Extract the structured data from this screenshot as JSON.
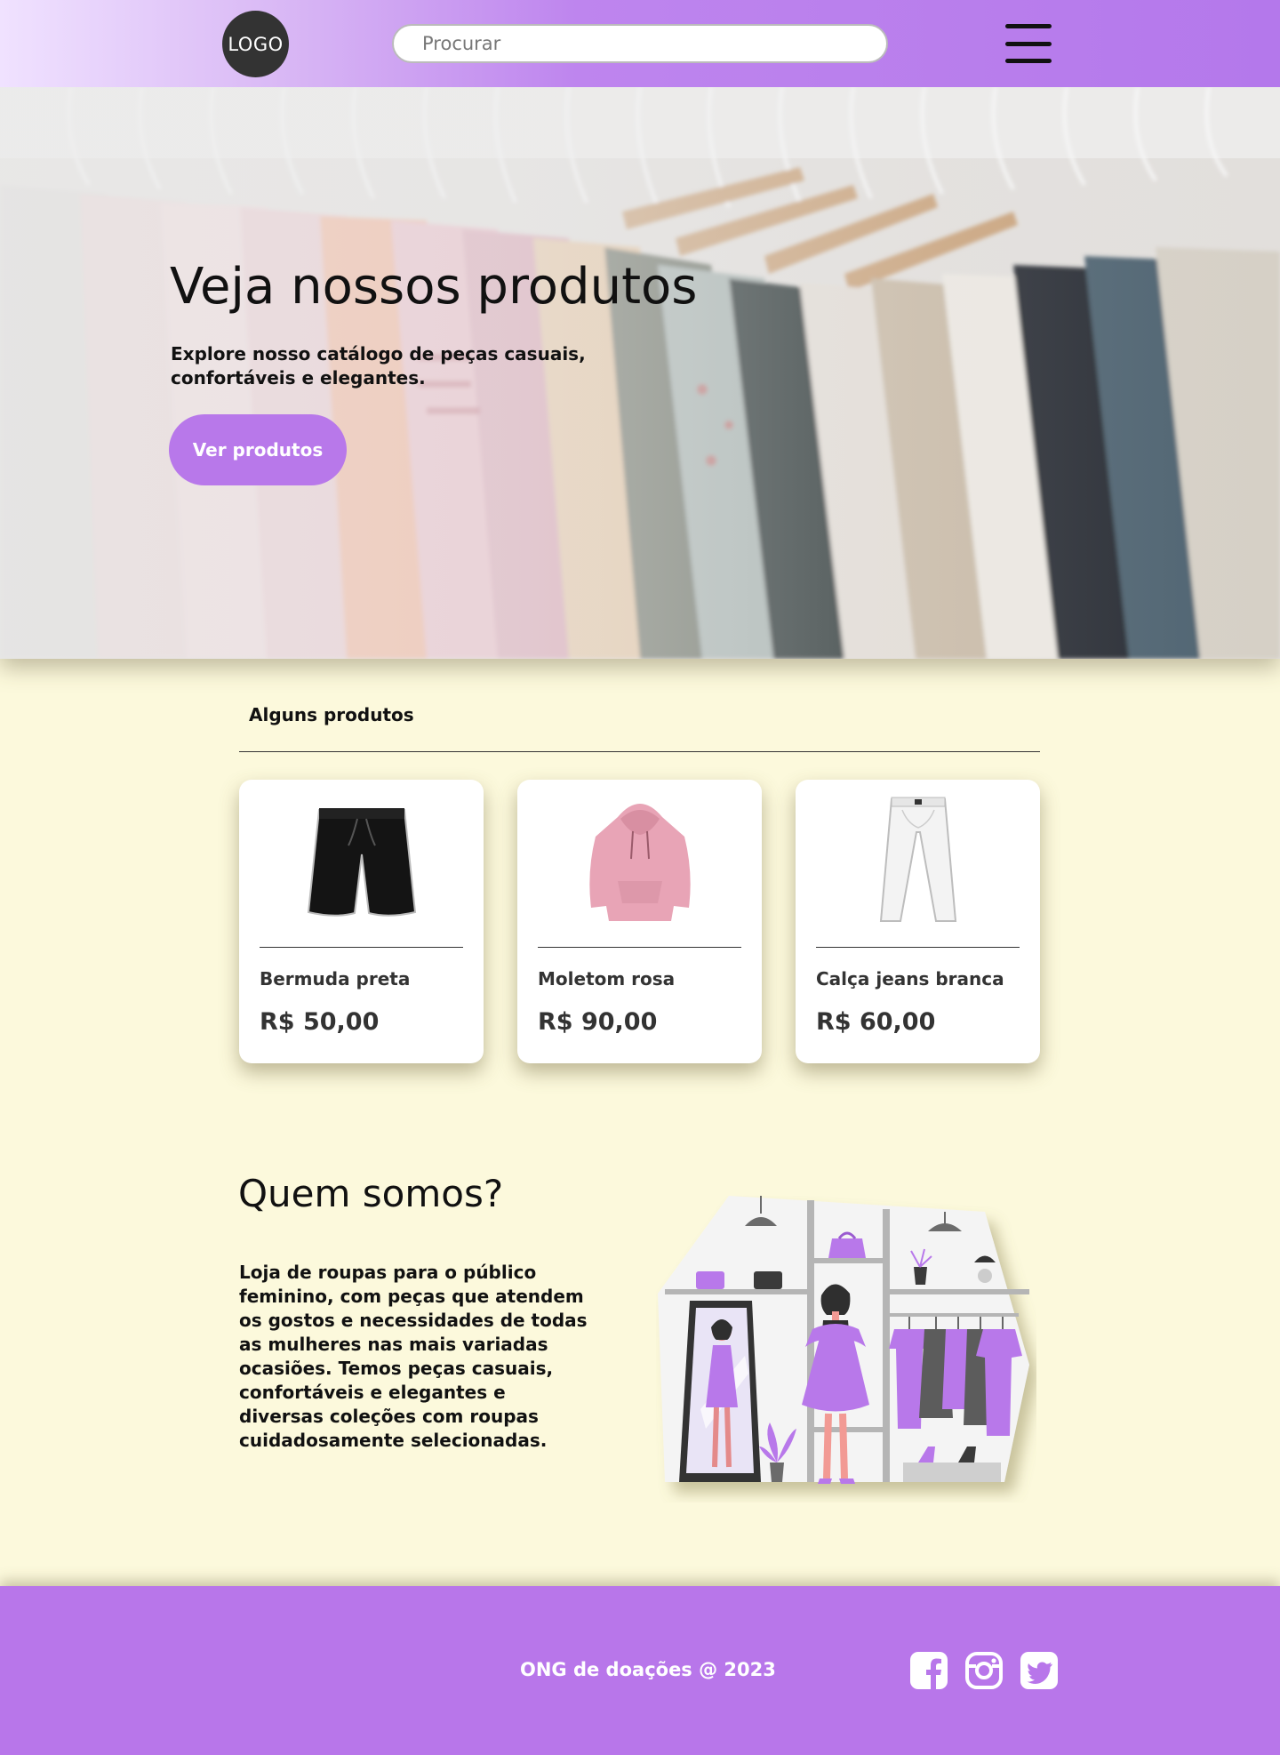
{
  "header": {
    "logo": "LOGO",
    "search_placeholder": "Procurar"
  },
  "hero": {
    "title": "Veja nossos produtos",
    "subtitle": "Explore nosso catálogo de peças casuais, confortáveis e elegantes.",
    "button": "Ver produtos"
  },
  "products": {
    "section_label": "Alguns produtos",
    "items": [
      {
        "name": "Bermuda preta",
        "price": "R$ 50,00"
      },
      {
        "name": "Moletom rosa",
        "price": "R$ 90,00"
      },
      {
        "name": "Calça jeans branca",
        "price": "R$ 60,00"
      }
    ]
  },
  "about": {
    "title": "Quem somos?",
    "text": "Loja de roupas para o público feminino, com peças que atendem os gostos e necessidades de todas as mulheres nas mais variadas ocasiões. Temos peças casuais, confortáveis e elegantes e diversas coleções com roupas cuidadosamente selecionadas."
  },
  "footer": {
    "text": "ONG de doações @ 2023"
  },
  "colors": {
    "accent": "#b878ea",
    "background": "#fcf9dc",
    "footer": "#b876ea"
  }
}
